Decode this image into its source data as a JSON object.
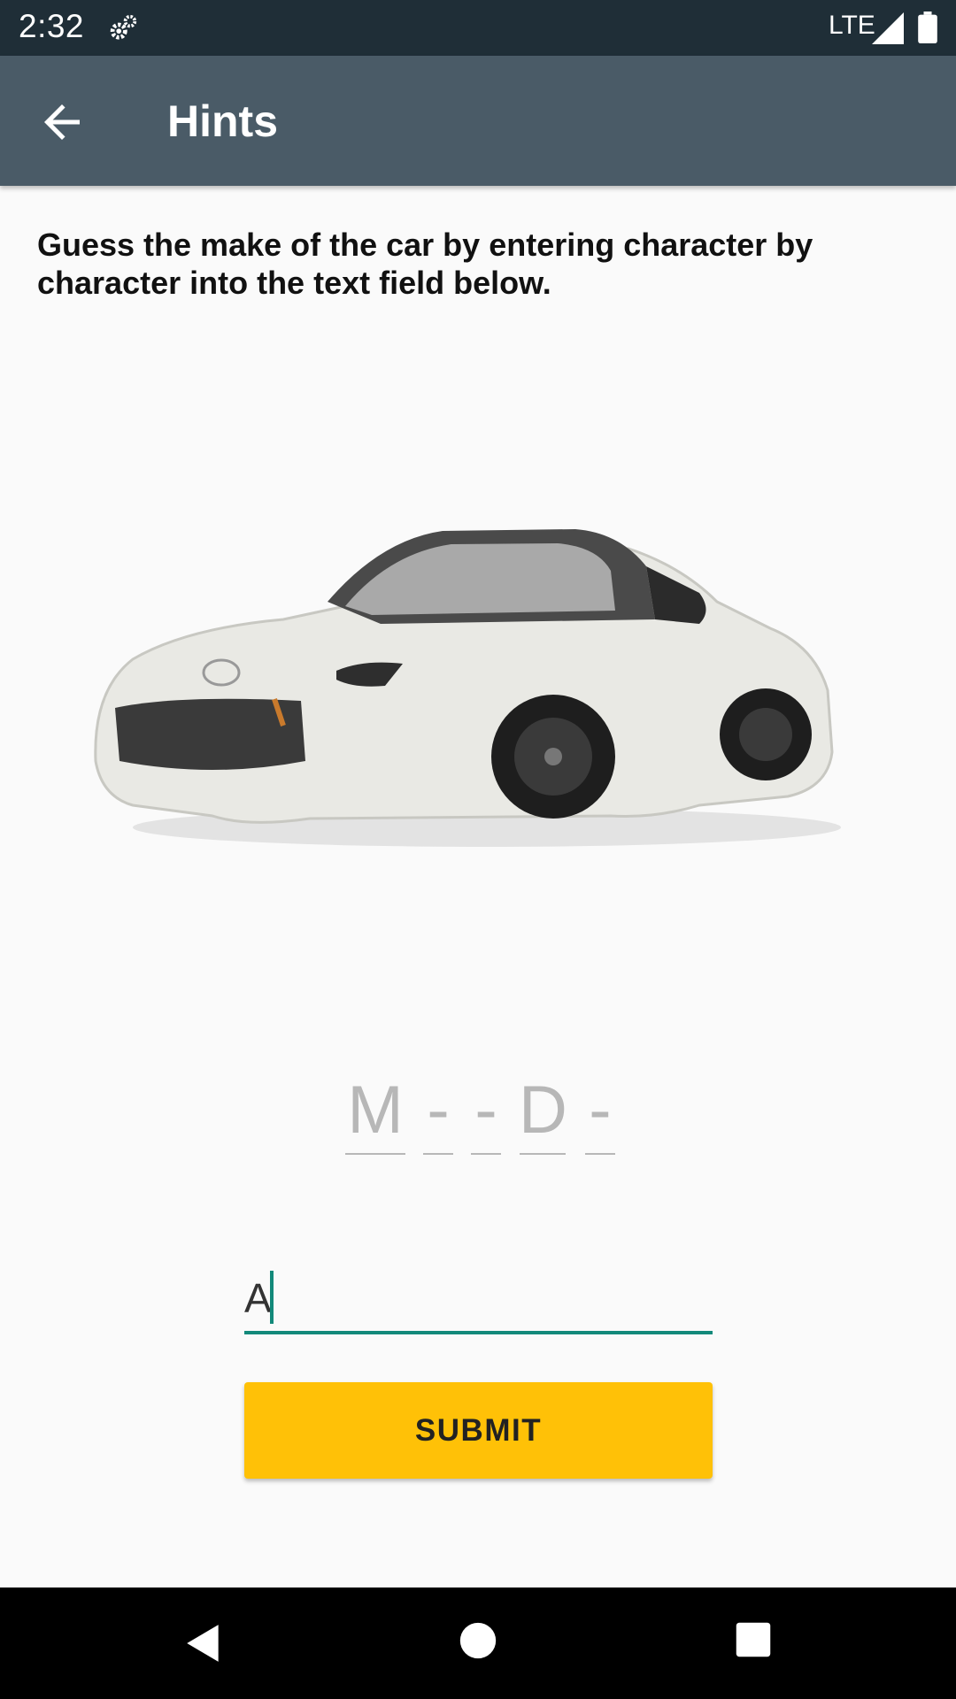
{
  "status_bar": {
    "time": "2:32",
    "network": "LTE",
    "icons": [
      "settings-sync-icon",
      "signal-icon",
      "battery-icon"
    ]
  },
  "app_bar": {
    "title": "Hints",
    "back_icon": "arrow-back-icon"
  },
  "instructions": "Guess the make of the car by entering character by character into the text field below.",
  "car_image": {
    "alt": "white convertible sports car"
  },
  "hint": {
    "characters": [
      "M",
      "-",
      "-",
      "D",
      "-"
    ]
  },
  "guess_input": {
    "value": "A"
  },
  "submit": {
    "label": "SUBMIT"
  },
  "colors": {
    "status_bar": "#1f2e37",
    "app_bar": "#4a5b67",
    "accent": "#12897a",
    "button": "#ffc107"
  },
  "nav_bar": {
    "icons": [
      "back-triangle-icon",
      "home-circle-icon",
      "recents-square-icon"
    ]
  }
}
